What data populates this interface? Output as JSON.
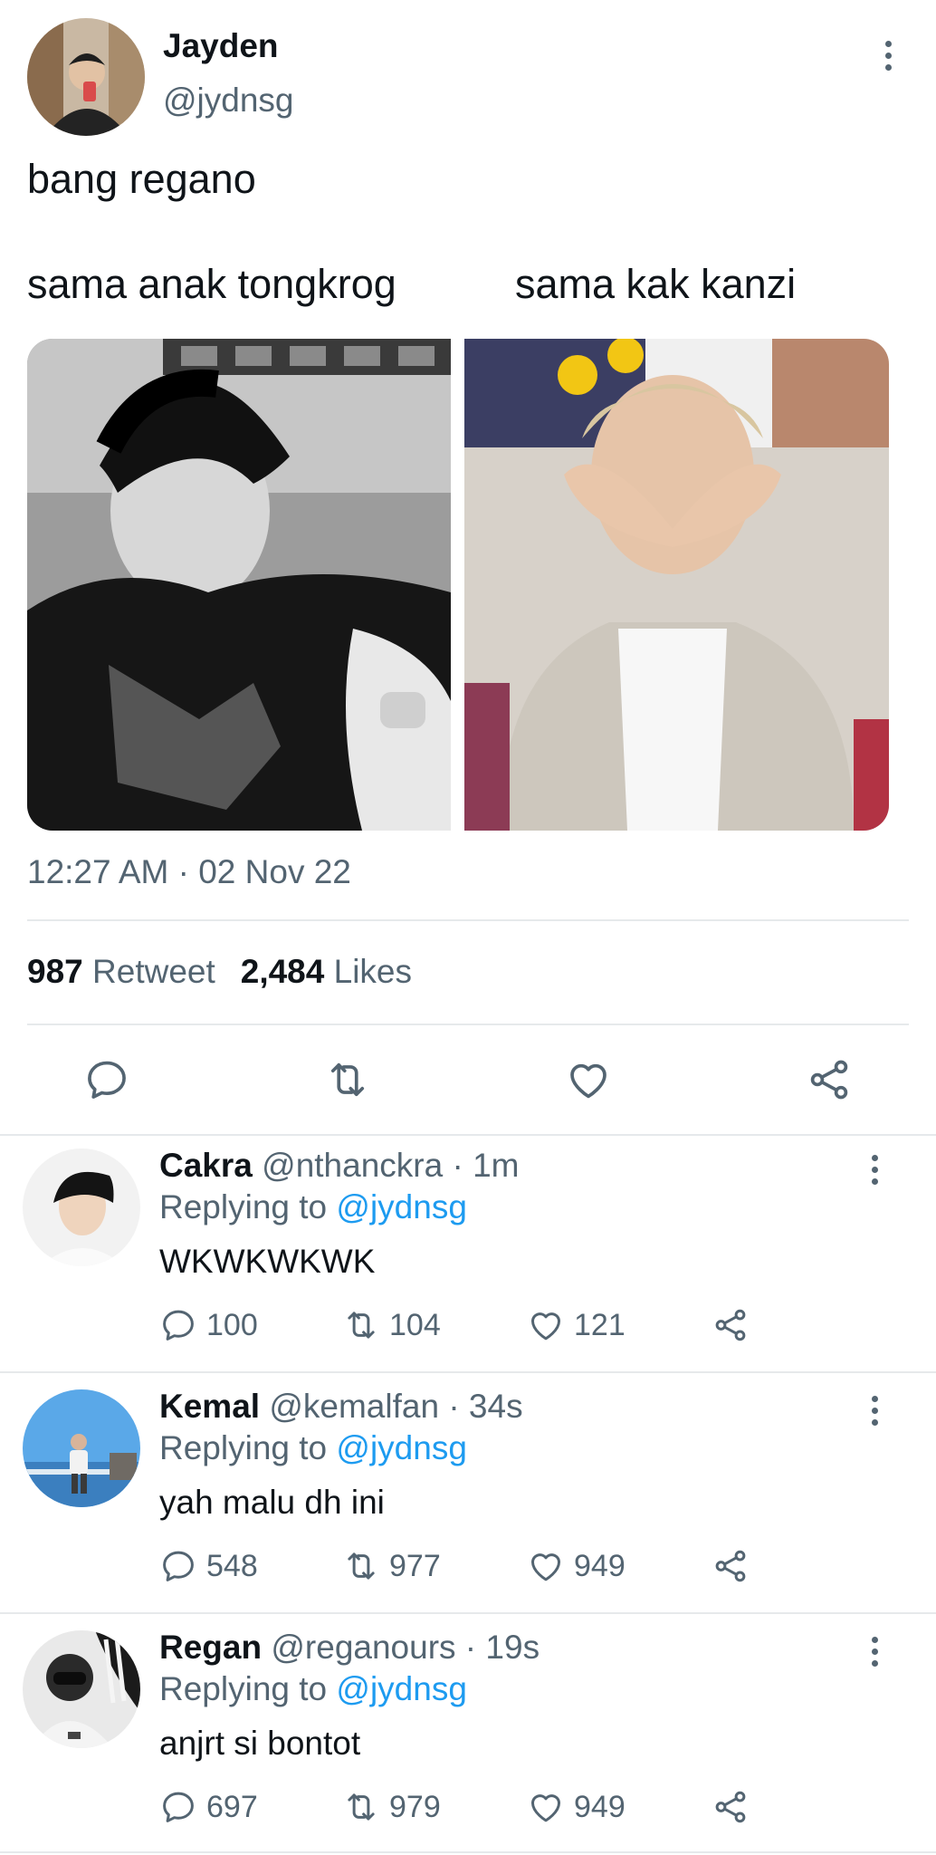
{
  "tweet": {
    "author_name": "Jayden",
    "author_handle": "@jydnsg",
    "text": "bang regano",
    "captions": [
      "sama anak tongkrog",
      "sama kak kanzi"
    ],
    "timestamp": "12:27 AM · 02 Nov 22",
    "retweet_count": "987",
    "retweet_label": "Retweet",
    "likes_count": "2,484",
    "likes_label": "Likes",
    "actions": [
      "reply-icon",
      "retweet-icon",
      "like-icon",
      "share-icon"
    ]
  },
  "colors": {
    "text_primary": "#0f1419",
    "text_secondary": "#536471",
    "link": "#1d9bf0",
    "divider": "#e6e9eb"
  },
  "replies": [
    {
      "name": "Cakra",
      "meta": "@nthanckra · 1m",
      "replying_label": "Replying to",
      "replying_handle": "@jydnsg",
      "text": "WKWKWKWK",
      "reply_count": "100",
      "retweet_count": "104",
      "like_count": "121"
    },
    {
      "name": "Kemal",
      "meta": "@kemalfan · 34s",
      "replying_label": "Replying to",
      "replying_handle": "@jydnsg",
      "text": "yah malu dh ini",
      "reply_count": "548",
      "retweet_count": "977",
      "like_count": "949"
    },
    {
      "name": "Regan",
      "meta": "@reganours · 19s",
      "replying_label": "Replying to",
      "replying_handle": "@jydnsg",
      "text": "anjrt si bontot",
      "reply_count": "697",
      "retweet_count": "979",
      "like_count": "949"
    }
  ]
}
